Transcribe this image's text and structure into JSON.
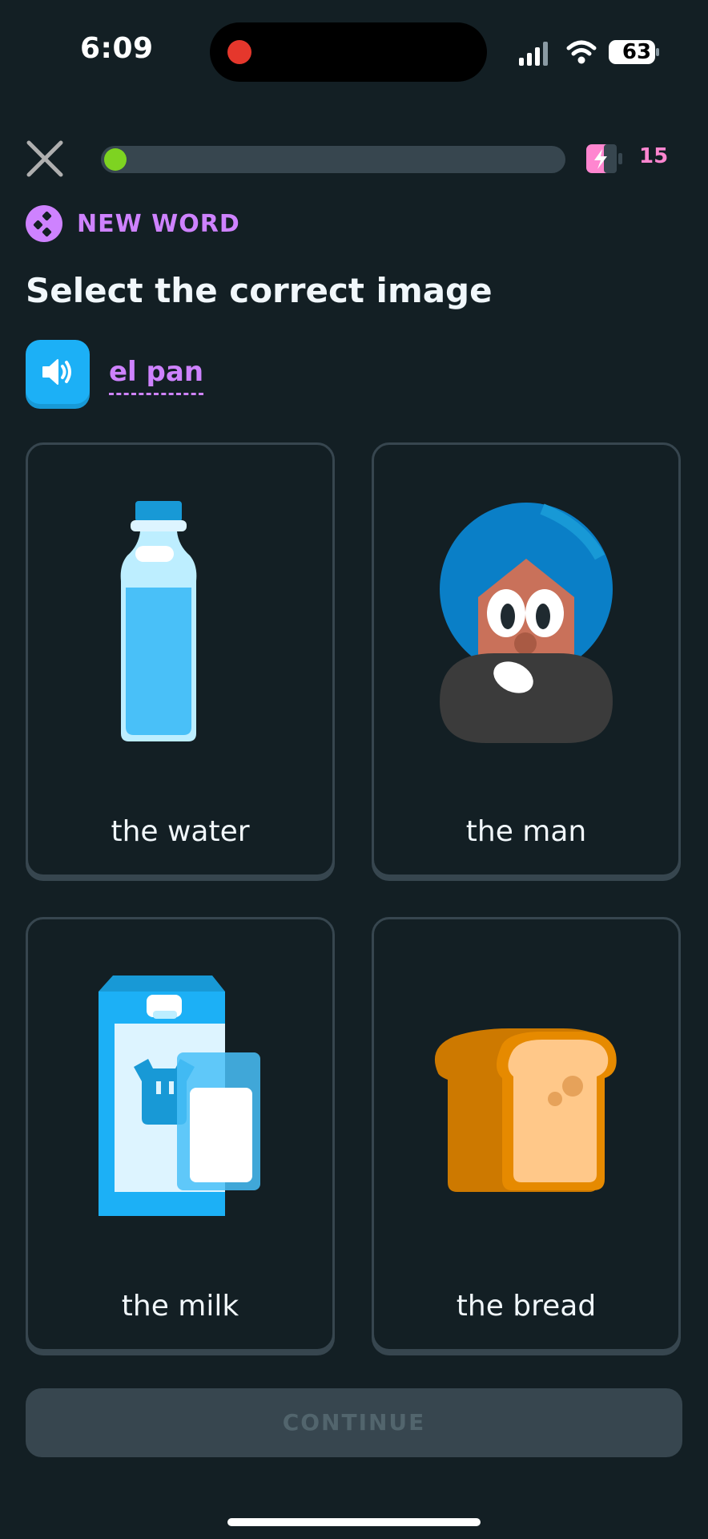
{
  "status_bar": {
    "time": "6:09",
    "battery": "63"
  },
  "header": {
    "progress_fraction": 0.02,
    "energy_count": "15"
  },
  "badge": {
    "label": "NEW WORD"
  },
  "prompt": "Select the correct image",
  "audio": {
    "word": "el pan"
  },
  "options": [
    {
      "label": "the water",
      "icon": "water-bottle-icon"
    },
    {
      "label": "the man",
      "icon": "man-illustration-icon"
    },
    {
      "label": "the milk",
      "icon": "milk-carton-icon"
    },
    {
      "label": "the bread",
      "icon": "bread-icon"
    }
  ],
  "continue_label": "CONTINUE",
  "colors": {
    "background": "#131f24",
    "accent_purple": "#ce82ff",
    "progress_green": "#7ed321",
    "speaker_blue": "#1cb0f6",
    "energy_pink": "#ff86d0"
  }
}
